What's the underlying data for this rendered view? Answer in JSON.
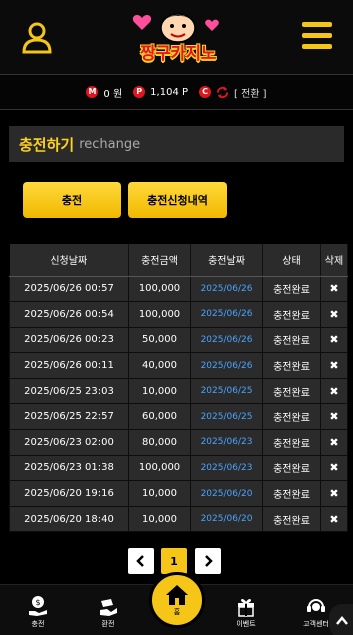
{
  "header": {
    "logo_text": "짱구카지노",
    "icons": {
      "user": "user-icon",
      "menu": "hamburger-icon"
    }
  },
  "balance": {
    "money_badge": "M",
    "money_value": "0 원",
    "point_badge": "P",
    "point_value": "1,104 P",
    "convert_badge": "C",
    "convert_label": "[ 전환 ]"
  },
  "section": {
    "title": "충전하기",
    "subtitle": "rechange"
  },
  "actions": {
    "charge_label": "충전",
    "history_label": "충전신청내역"
  },
  "table": {
    "headers": [
      "신청날짜",
      "충전금액",
      "충전날짜",
      "상태",
      "삭제"
    ],
    "rows": [
      {
        "req": "2025/06/26 00:57",
        "amount": "100,000",
        "date": "2025/06/26",
        "status": "충전완료",
        "del": "✖"
      },
      {
        "req": "2025/06/26 00:54",
        "amount": "100,000",
        "date": "2025/06/26",
        "status": "충전완료",
        "del": "✖"
      },
      {
        "req": "2025/06/26 00:23",
        "amount": "50,000",
        "date": "2025/06/26",
        "status": "충전완료",
        "del": "✖"
      },
      {
        "req": "2025/06/26 00:11",
        "amount": "40,000",
        "date": "2025/06/26",
        "status": "충전완료",
        "del": "✖"
      },
      {
        "req": "2025/06/25 23:03",
        "amount": "10,000",
        "date": "2025/06/25",
        "status": "충전완료",
        "del": "✖"
      },
      {
        "req": "2025/06/25 22:57",
        "amount": "60,000",
        "date": "2025/06/25",
        "status": "충전완료",
        "del": "✖"
      },
      {
        "req": "2025/06/23 02:00",
        "amount": "80,000",
        "date": "2025/06/23",
        "status": "충전완료",
        "del": "✖"
      },
      {
        "req": "2025/06/23 01:38",
        "amount": "100,000",
        "date": "2025/06/23",
        "status": "충전완료",
        "del": "✖"
      },
      {
        "req": "2025/06/20 19:16",
        "amount": "10,000",
        "date": "2025/06/20",
        "status": "충전완료",
        "del": "✖"
      },
      {
        "req": "2025/06/20 18:40",
        "amount": "10,000",
        "date": "2025/06/20",
        "status": "충전완료",
        "del": "✖"
      }
    ]
  },
  "pagination": {
    "prev": "‹",
    "current": "1",
    "next": "›"
  },
  "bottom_nav": {
    "charge": "충전",
    "exchange": "환전",
    "home": "홈",
    "event": "이벤트",
    "support": "고객센터"
  },
  "colors": {
    "accent": "#f5c518",
    "link_blue": "#4aa3ff",
    "badge_red": "#e0161f"
  }
}
